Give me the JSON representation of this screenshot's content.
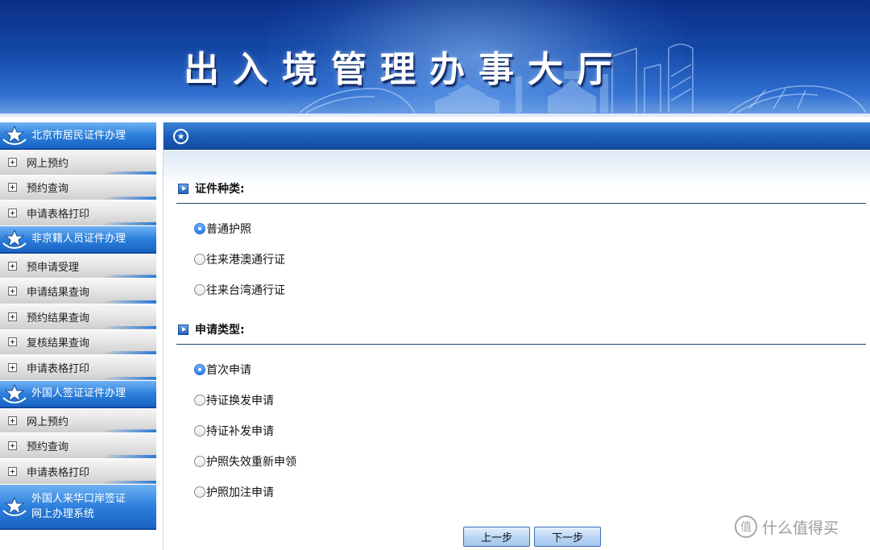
{
  "banner": {
    "title": "出入境管理办事大厅"
  },
  "sidebar": {
    "sections": [
      {
        "title": "北京市居民证件办理",
        "items": [
          "网上预约",
          "预约查询",
          "申请表格打印"
        ]
      },
      {
        "title": "非京籍人员证件办理",
        "items": [
          "预申请受理",
          "申请结果查询",
          "预约结果查询",
          "复核结果查询",
          "申请表格打印"
        ]
      },
      {
        "title": "外国人签证证件办理",
        "items": [
          "网上预约",
          "预约查询",
          "申请表格打印"
        ]
      },
      {
        "title_line1": "外国人来华口岸签证",
        "title_line2": "网上办理系统"
      }
    ]
  },
  "main": {
    "doc_type": {
      "label": "证件种类:",
      "options": [
        "普通护照",
        "往来港澳通行证",
        "往来台湾通行证"
      ],
      "selected": "普通护照"
    },
    "apply_type": {
      "label": "申请类型:",
      "options": [
        "首次申请",
        "持证换发申请",
        "持证补发申请",
        "护照失效重新申领",
        "护照加注申请"
      ],
      "selected": "首次申请"
    },
    "buttons": {
      "prev": "上一步",
      "next": "下一步"
    }
  },
  "watermark": {
    "logo_char": "值",
    "text": "什么值得买"
  },
  "colors": {
    "banner_dark": "#0b2f86",
    "header_blue": "#1b5cb8",
    "sidebar_header": "#2c7fdc",
    "radio_checked": "#2d7de6"
  }
}
